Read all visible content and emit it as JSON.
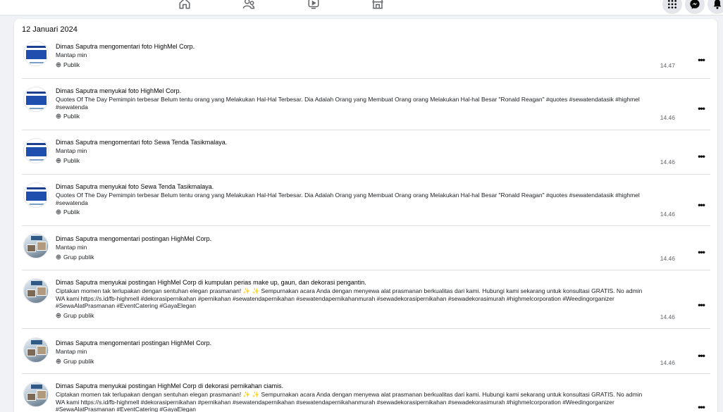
{
  "nav": {
    "icons": [
      "home-icon",
      "friends-icon",
      "video-icon",
      "marketplace-icon"
    ],
    "actions": [
      "menu-grid-icon",
      "messenger-icon",
      "notifications-icon"
    ]
  },
  "log": {
    "date": "12 Januari 2024",
    "entries": [
      {
        "title": "Dimas Saputra mengomentari foto HighMel Corp.",
        "excerpt": "Mantap min",
        "audience": "Publik",
        "time": "14.47",
        "thumb": "quote"
      },
      {
        "title": "Dimas Saputra menyukai foto HighMel Corp.",
        "excerpt": "Quotes Of The Day Pemimpin terbesar Belum tentu orang yang Melakukan Hal-Hal Terbesar. Dia Adalah Orang yang Membuat Orang orang Melakukan Hal-hal Besar \"Ronald Reagan\" #quotes #sewatendatasik #highmel #sewatenda",
        "audience": "Publik",
        "time": "14.46",
        "thumb": "quote"
      },
      {
        "title": "Dimas Saputra mengomentari foto Sewa Tenda Tasikmalaya.",
        "excerpt": "Mantap min",
        "audience": "Publik",
        "time": "14.46",
        "thumb": "quote"
      },
      {
        "title": "Dimas Saputra menyukai foto Sewa Tenda Tasikmalaya.",
        "excerpt": "Quotes Of The Day Pemimpin terbesar Belum tentu orang yang Melakukan Hal-Hal Terbesar. Dia Adalah Orang yang Membuat Orang orang Melakukan Hal-hal Besar \"Ronald Reagan\" #quotes #sewatendatasik #highmel #sewatenda",
        "audience": "Publik",
        "time": "14.46",
        "thumb": "quote"
      },
      {
        "title": "Dimas Saputra mengomentari postingan HighMel Corp.",
        "excerpt": "Mantap min",
        "audience": "Grup publik",
        "time": "14.46",
        "thumb": "photo"
      },
      {
        "title": "Dimas Saputra menyukai postingan HighMel Corp di kumpulan perias make up, gaun, dan dekorasi pengantin.",
        "excerpt": "Ciptakan momen tak terlupakan dengan sentuhan elegan prasmanan! ✨ ✨ Sempurnakan acara Anda dengan menyewa alat prasmanan berkualitas dari kami. Hubungi kami sekarang untuk konsultasi GRATIS. No admin WA kami https://s.id/fb-highmell #dekorasipernikahan #pernikahan #sewatendapernikahan #sewatendapernikahanmurah #sewadekorasipernikahan #sewadekorasimurah #highmelcorporation #Weedingorganizer #SewaAlatPrasmanan #EventCatering #GayaElegan",
        "audience": "Grup publik",
        "time": "14.46",
        "thumb": "photo"
      },
      {
        "title": "Dimas Saputra mengomentari postingan HighMel Corp.",
        "excerpt": "Mantap min",
        "audience": "Grup publik",
        "time": "14.46",
        "thumb": "photo"
      },
      {
        "title": "Dimas Saputra menyukai postingan HighMel Corp di dekorasi pernikahan ciamis.",
        "excerpt": "Ciptakan momen tak terlupakan dengan sentuhan elegan prasmanan! ✨ ✨ Sempurnakan acara Anda dengan menyewa alat prasmanan berkualitas dari kami. Hubungi kami sekarang untuk konsultasi GRATIS. No admin WA kami https://s.id/fb-highmell #dekorasipernikahan #pernikahan #sewatendapernikahan #sewatendapernikahanmurah #sewadekorasipernikahan #sewadekorasimurah #highmelcorporation #Weedingorganizer #SewaAlatPrasmanan #EventCatering #GayaElegan",
        "audience": "",
        "time": "",
        "thumb": "photo"
      }
    ]
  },
  "colors": {
    "divider": "#dadde1",
    "accent": "#1877f2",
    "muted": "#65676b"
  }
}
